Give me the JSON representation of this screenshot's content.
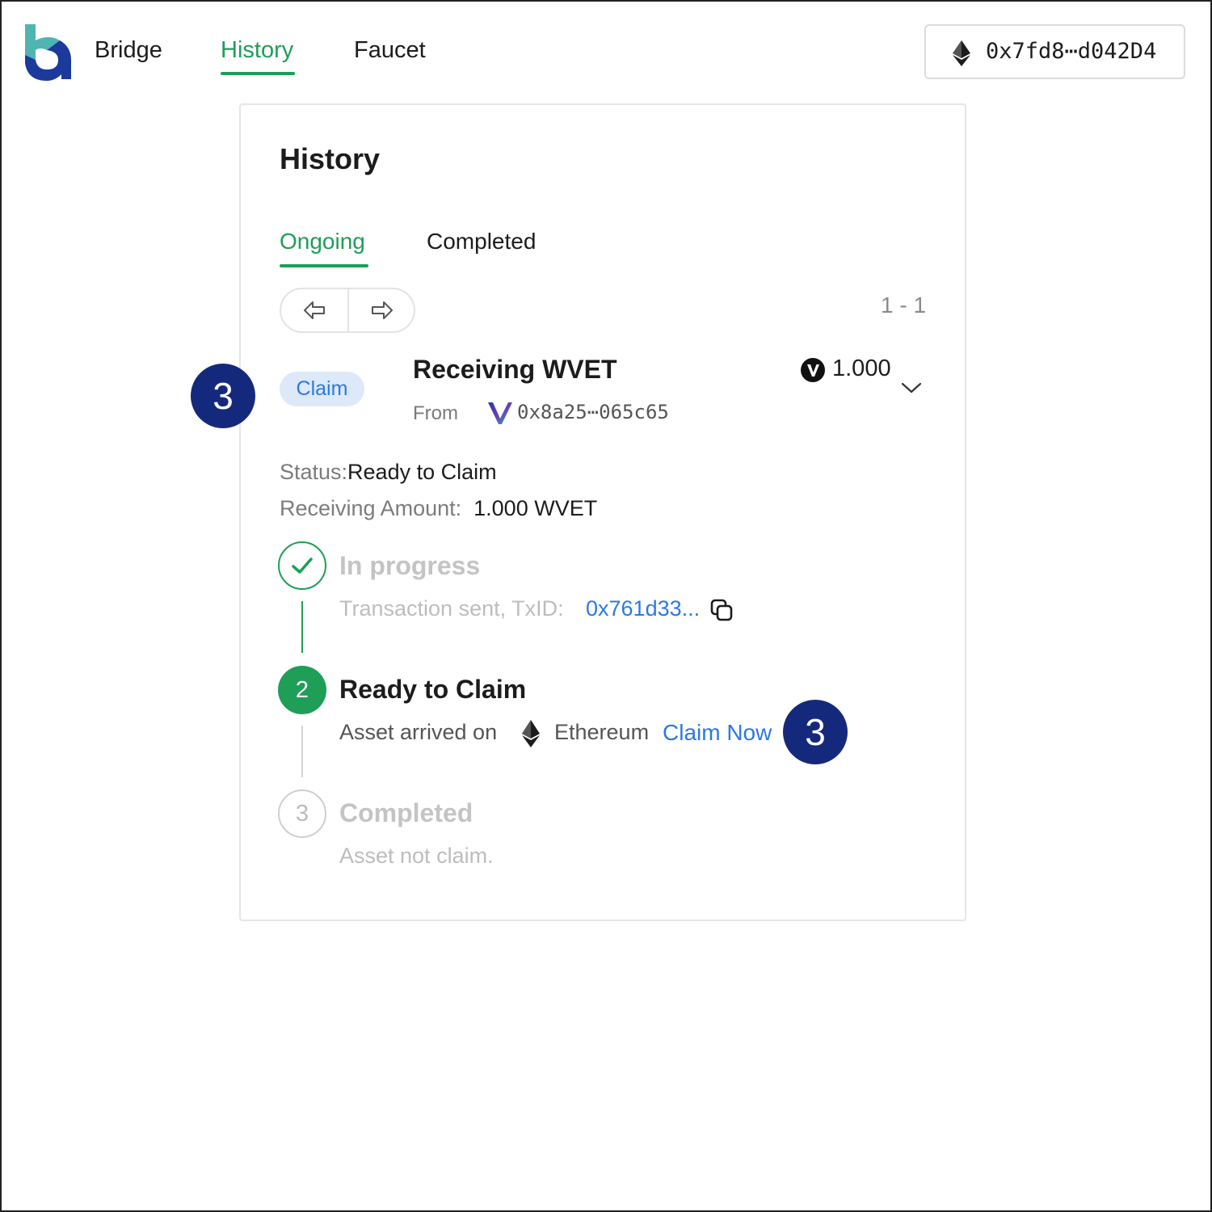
{
  "colors": {
    "accent_green": "#1e9e57",
    "link_blue": "#2b78e4",
    "annotation_navy": "#15297c",
    "badge_bg": "#dde9f8"
  },
  "header": {
    "logo_icon": "bridge-logo-icon",
    "nav": {
      "bridge": "Bridge",
      "history": "History",
      "faucet": "Faucet"
    },
    "active_nav": "History",
    "wallet": {
      "chain_icon": "ethereum-icon",
      "address": "0x7fd8⋯d042D4"
    }
  },
  "history": {
    "title": "History",
    "tabs": {
      "ongoing": "Ongoing",
      "completed": "Completed"
    },
    "active_tab": "Ongoing",
    "pagination": {
      "prev_icon": "arrow-left-icon",
      "next_icon": "arrow-right-icon",
      "range": "1 - 1"
    },
    "transaction": {
      "badge": "Claim",
      "title": "Receiving WVET",
      "from_label": "From",
      "from_icon": "vechain-icon",
      "from_address": "0x8a25⋯065c65",
      "amount_icon": "vet-token-icon",
      "amount": "1.000",
      "status_label": "Status:",
      "status_value": "Ready to Claim",
      "receiving_label": "Receiving Amount:",
      "receiving_value": "1.000 WVET",
      "steps": [
        {
          "marker": "check-icon",
          "title": "In progress",
          "desc": "Transaction sent, TxID:",
          "txid": "0x761d33...",
          "copy_icon": "copy-icon"
        },
        {
          "marker": "2",
          "title": "Ready to Claim",
          "desc": "Asset arrived on",
          "chain_icon": "ethereum-icon",
          "chain": "Ethereum",
          "action": "Claim Now"
        },
        {
          "marker": "3",
          "title": "Completed",
          "desc": "Asset not claim."
        }
      ]
    }
  },
  "annotations": [
    "3",
    "3"
  ]
}
